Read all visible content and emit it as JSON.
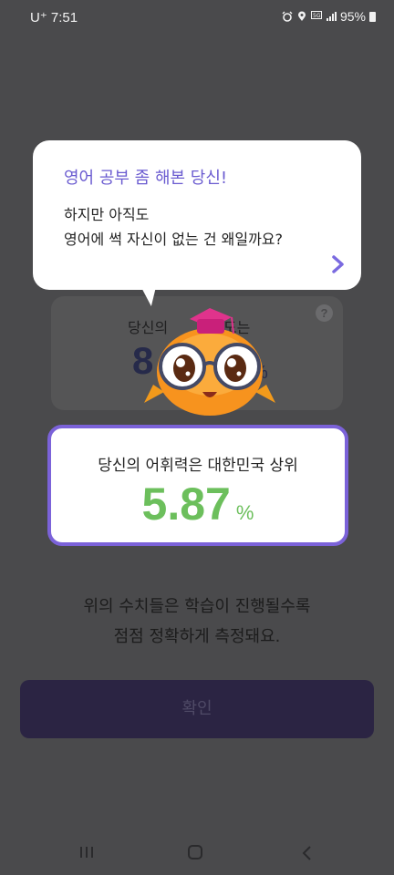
{
  "status_bar": {
    "carrier": "U⁺ 7:51",
    "battery": "95%",
    "icons": [
      "alarm-icon",
      "location-icon",
      "5g-icon",
      "signal-icon",
      "battery-icon"
    ]
  },
  "speech_bubble": {
    "title": "영어 공부 좀 해본 당신!",
    "line1": "하지만 아직도",
    "line2": "영어에 썩 자신이 없는 건 왜일까요?",
    "next_icon": "chevron-right-icon"
  },
  "background_card": {
    "label": "당신의",
    "label_end": "해도는",
    "value_partial": "8",
    "unit": "%"
  },
  "result": {
    "label": "당신의 어휘력은 대한민국 상위",
    "value": "5.87",
    "unit": "%"
  },
  "note": {
    "line1": "위의 수치들은 학습이 진행될수록",
    "line2": "점점 정확하게 측정돼요."
  },
  "confirm_button": {
    "label": "확인"
  },
  "colors": {
    "accent_purple": "#7b62d9",
    "result_green": "#6cbf5c",
    "title_purple": "#6a5bd0",
    "button_dark": "#2b2443"
  }
}
